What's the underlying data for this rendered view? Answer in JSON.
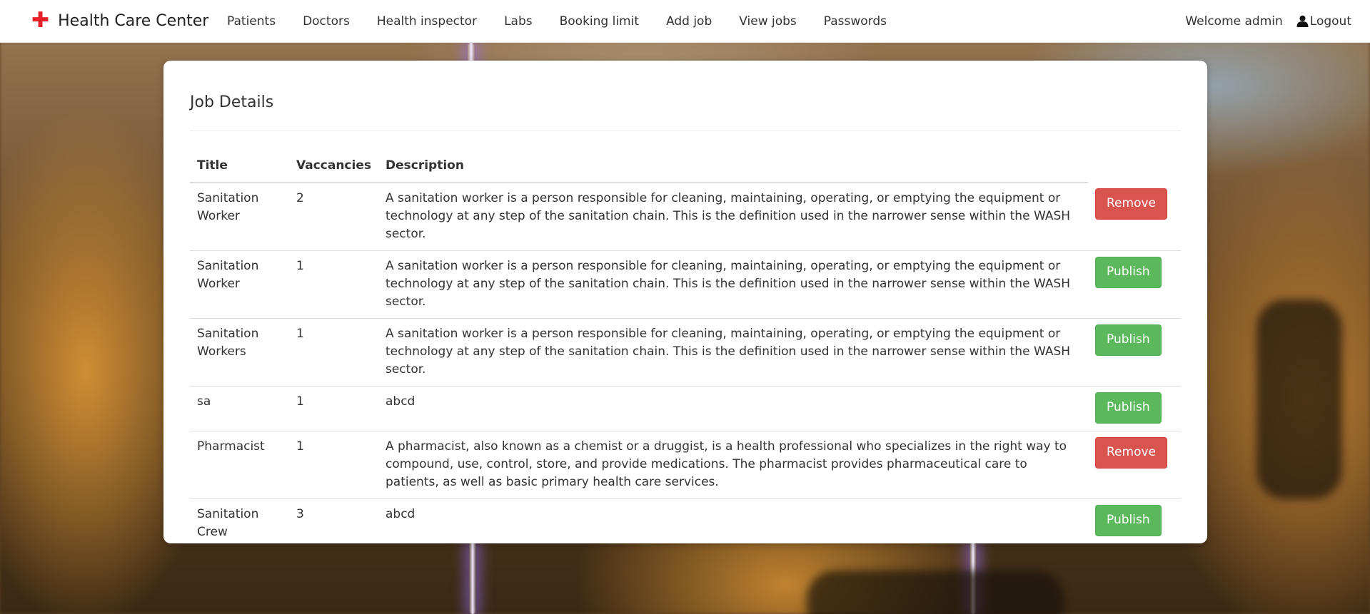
{
  "brand": {
    "icon": "red-cross-icon",
    "icon_color": "#e8202a",
    "title": "Health Care Center"
  },
  "nav": {
    "links": [
      "Patients",
      "Doctors",
      "Health inspector",
      "Labs",
      "Booking limit",
      "Add job",
      "View jobs",
      "Passwords"
    ],
    "welcome": "Welcome admin",
    "logout": "Logout"
  },
  "card": {
    "title": "Job Details"
  },
  "table": {
    "headers": {
      "title": "Title",
      "vacancies": "Vaccancies",
      "description": "Description"
    },
    "rows": [
      {
        "title": "Sanitation Worker",
        "vacancies": "2",
        "description": "A sanitation worker is a person responsible for cleaning, maintaining, operating, or emptying the equipment or technology at any step of the sanitation chain. This is the definition used in the narrower sense within the WASH sector.",
        "action": "Remove",
        "action_type": "remove"
      },
      {
        "title": "Sanitation Worker",
        "vacancies": "1",
        "description": "A sanitation worker is a person responsible for cleaning, maintaining, operating, or emptying the equipment or technology at any step of the sanitation chain. This is the definition used in the narrower sense within the WASH sector.",
        "action": "Publish",
        "action_type": "publish"
      },
      {
        "title": "Sanitation Workers",
        "vacancies": "1",
        "description": "A sanitation worker is a person responsible for cleaning, maintaining, operating, or emptying the equipment or technology at any step of the sanitation chain. This is the definition used in the narrower sense within the WASH sector.",
        "action": "Publish",
        "action_type": "publish"
      },
      {
        "title": "sa",
        "vacancies": "1",
        "description": "abcd",
        "action": "Publish",
        "action_type": "publish"
      },
      {
        "title": "Pharmacist",
        "vacancies": "1",
        "description": "A pharmacist, also known as a chemist or a druggist, is a health professional who specializes in the right way to compound, use, control, store, and provide medications. The pharmacist provides pharmaceutical care to patients, as well as basic primary health care services.",
        "action": "Remove",
        "action_type": "remove"
      },
      {
        "title": "Sanitation Crew",
        "vacancies": "3",
        "description": "abcd",
        "action": "Publish",
        "action_type": "publish"
      }
    ]
  },
  "colors": {
    "remove": "#d9534f",
    "publish": "#5cb85c"
  }
}
